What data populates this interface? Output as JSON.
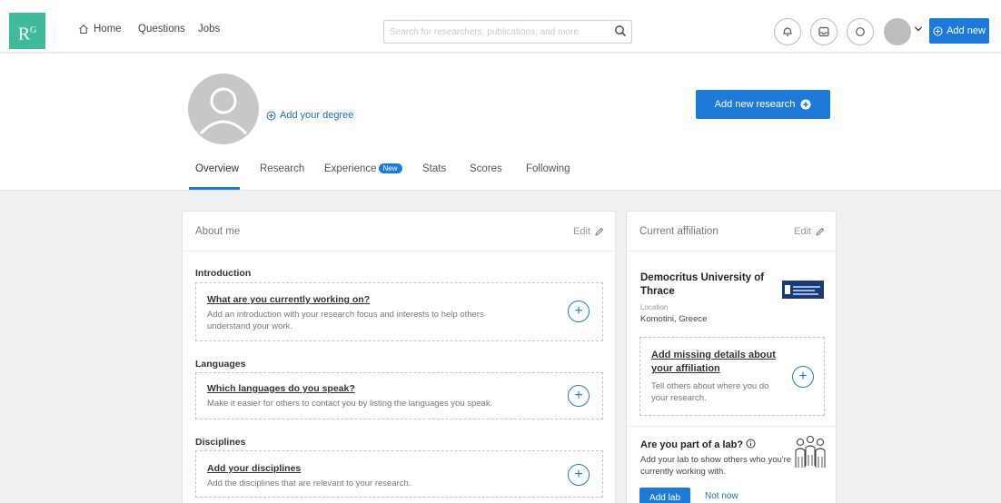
{
  "logo": {
    "text": "R",
    "sup": "G"
  },
  "nav": {
    "home_label": "Home",
    "questions_label": "Questions",
    "jobs_label": "Jobs",
    "search_placeholder": "Search for researchers, publications, and more",
    "add_new_label": "Add new"
  },
  "profile": {
    "add_degree_label": "Add your degree",
    "add_research_label": "Add new research",
    "tabs": [
      {
        "label": "Overview",
        "active": true
      },
      {
        "label": "Research"
      },
      {
        "label": "Experience",
        "badge": "New"
      },
      {
        "label": "Stats"
      },
      {
        "label": "Scores"
      },
      {
        "label": "Following"
      }
    ]
  },
  "about": {
    "title": "About me",
    "edit_label": "Edit",
    "sections": [
      {
        "label": "Introduction",
        "prompt_title": "What are you currently working on?",
        "prompt_desc": "Add an introduction with your research focus and interests to help others understand your work."
      },
      {
        "label": "Languages",
        "prompt_title": "Which languages do you speak?",
        "prompt_desc": "Make it easier for others to contact you by listing the languages you speak."
      },
      {
        "label": "Disciplines",
        "prompt_title": "Add your disciplines",
        "prompt_desc": "Add the disciplines that are relevant to your research."
      }
    ]
  },
  "affiliation": {
    "title": "Current affiliation",
    "edit_label": "Edit",
    "institution": "Democritus University of Thrace",
    "location_label": "Location",
    "location_value": "Komotini, Greece",
    "missing_title": "Add missing details about your affiliation",
    "missing_desc": "Tell others about where you do your research.",
    "lab_title": "Are you part of a lab?",
    "lab_desc": "Add your lab to show others who you're currently working with.",
    "add_lab_label": "Add lab",
    "not_now_label": "Not now"
  },
  "colors": {
    "accent": "#1e7ad8",
    "brand": "#40ba9b"
  }
}
